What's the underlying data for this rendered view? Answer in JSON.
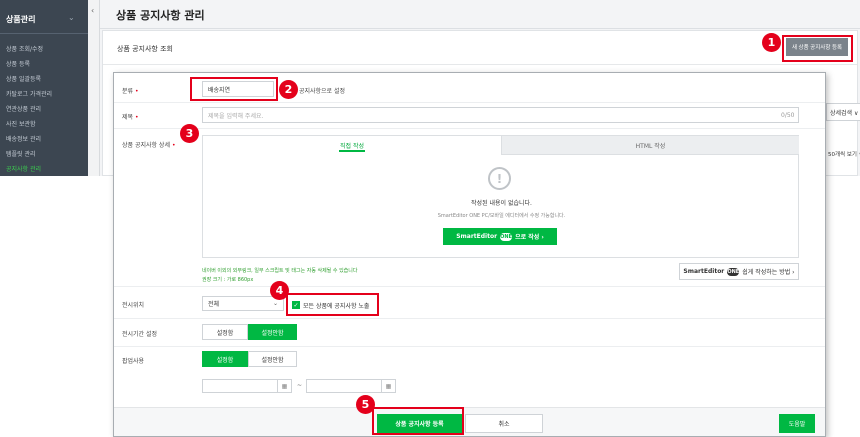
{
  "sidebar": {
    "title": "상품관리",
    "items": [
      {
        "label": "상품 조회/수정",
        "active": false
      },
      {
        "label": "상품 등록",
        "active": false
      },
      {
        "label": "상품 일괄등록",
        "active": false
      },
      {
        "label": "카탈로그 가격관리",
        "active": false
      },
      {
        "label": "연관상품 관리",
        "active": false
      },
      {
        "label": "사진 보관함",
        "active": false
      },
      {
        "label": "배송정보 관리",
        "active": false
      },
      {
        "label": "템플릿 관리",
        "active": false
      },
      {
        "label": "공지사항 관리",
        "active": true
      }
    ]
  },
  "header": {
    "title": "상품 공지사항 관리",
    "collapse_glyph": "‹"
  },
  "list_panel": {
    "section_title": "상품 공지사항 조회",
    "new_button": "새 상품 공지사항 등록",
    "peek_detail_search": "상세검색 ∨",
    "peek_view_count": "50개씩 보기 ∨"
  },
  "form": {
    "category": {
      "label": "분류",
      "value": "배송지연",
      "side_text": "중요 공지사항으로 설정"
    },
    "title": {
      "label": "제목",
      "placeholder": "제목을 입력해 주세요.",
      "counter": "0/50"
    },
    "detail": {
      "label": "상품 공지사항 상세",
      "tabs": [
        "직접 작성",
        "HTML 작성"
      ],
      "empty_icon": "!",
      "empty_message": "작성된 내용이 없습니다.",
      "empty_sub": "SmartEditor ONE PC/모바일 에디터에서 수정 가능합니다.",
      "editor_button_left": "SmartEditor",
      "editor_button_badge": "ONE",
      "editor_button_right": "으로 작성 ›",
      "notice_line1": "네이버 이외의 외부링크, 일부 스크립트 및 태그는 자동 삭제될 수 있습니다",
      "notice_line2": "권장 크기 : 가로 860px",
      "guide_left": "SmartEditor",
      "guide_badge": "ONE",
      "guide_right": "쉽게 작성하는 방법 ›"
    },
    "display": {
      "label": "전시위치",
      "select_value": "전체",
      "checkbox_label": "모든 상품에 공지사항 노출",
      "checked": true
    },
    "period": {
      "label": "전시기간 설정",
      "options": [
        "설정함",
        "설정안함"
      ],
      "selected": "설정안함"
    },
    "popup": {
      "label": "팝업사용",
      "options": [
        "설정함",
        "설정안함"
      ],
      "selected": "설정함",
      "tilde": "~",
      "calendar_glyph": "▦"
    },
    "footer": {
      "submit": "상품 공지사항 등록",
      "cancel": "취소",
      "peek_button": "도움말"
    }
  },
  "callouts": [
    "1",
    "2",
    "3",
    "4",
    "5"
  ],
  "colors": {
    "accent_green": "#00b843",
    "callout_red": "#e4001b",
    "sidebar_bg": "#3c4651"
  }
}
